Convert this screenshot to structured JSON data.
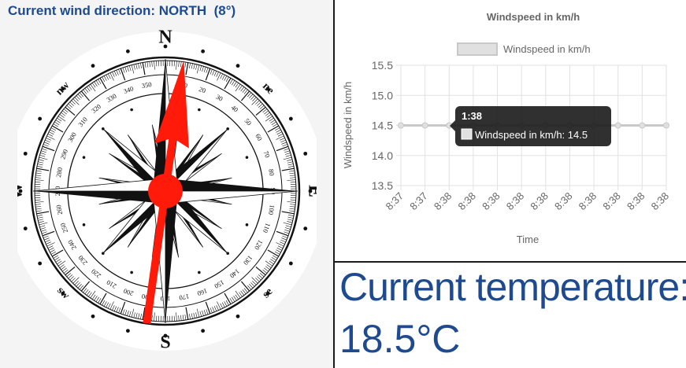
{
  "wind": {
    "title": "Current wind direction: NORTH  (8°)",
    "direction_label": "NORTH",
    "degrees": 8,
    "compass": {
      "cardinals": {
        "north": "N",
        "south": "S",
        "east": "E",
        "west": "W"
      },
      "intercardinals": {
        "ne": "ne",
        "se": "se",
        "sw": "sw",
        "nw": "nw"
      },
      "degree_labels": [
        "10",
        "20",
        "30",
        "40",
        "50",
        "60",
        "70",
        "80",
        "90",
        "100",
        "110",
        "120",
        "130",
        "140",
        "150",
        "160",
        "170",
        "180",
        "190",
        "200",
        "210",
        "220",
        "230",
        "240",
        "250",
        "260",
        "270",
        "280",
        "290",
        "300",
        "310",
        "320",
        "330",
        "340",
        "350"
      ],
      "needle_color": "#ff1a0a"
    }
  },
  "chart_data": {
    "type": "line",
    "title": "Windspeed in km/h",
    "xlabel": "Time",
    "ylabel": "Windspeed in km/h",
    "ylim": [
      13.5,
      15.5
    ],
    "yticks": [
      "15.5",
      "15.0",
      "14.5",
      "14.0",
      "13.5"
    ],
    "categories": [
      "8:37",
      "8:37",
      "8:38",
      "8:38",
      "8:38",
      "8:38",
      "8:38",
      "8:38",
      "8:38",
      "8:38",
      "8:38",
      "8:38"
    ],
    "series": [
      {
        "name": "Windspeed in km/h",
        "values": [
          14.5,
          14.5,
          14.5,
          14.5,
          14.5,
          14.5,
          14.5,
          14.5,
          14.5,
          14.5,
          14.5,
          14.5
        ],
        "color": "#c8c8c8"
      }
    ],
    "legend": "top",
    "grid": true,
    "tooltip": {
      "title": "1:38",
      "label": "Windspeed in km/h: 14.5"
    }
  },
  "temperature": {
    "label": "Current temperature:",
    "value": "18.5°C",
    "color": "#1e4a8f"
  }
}
